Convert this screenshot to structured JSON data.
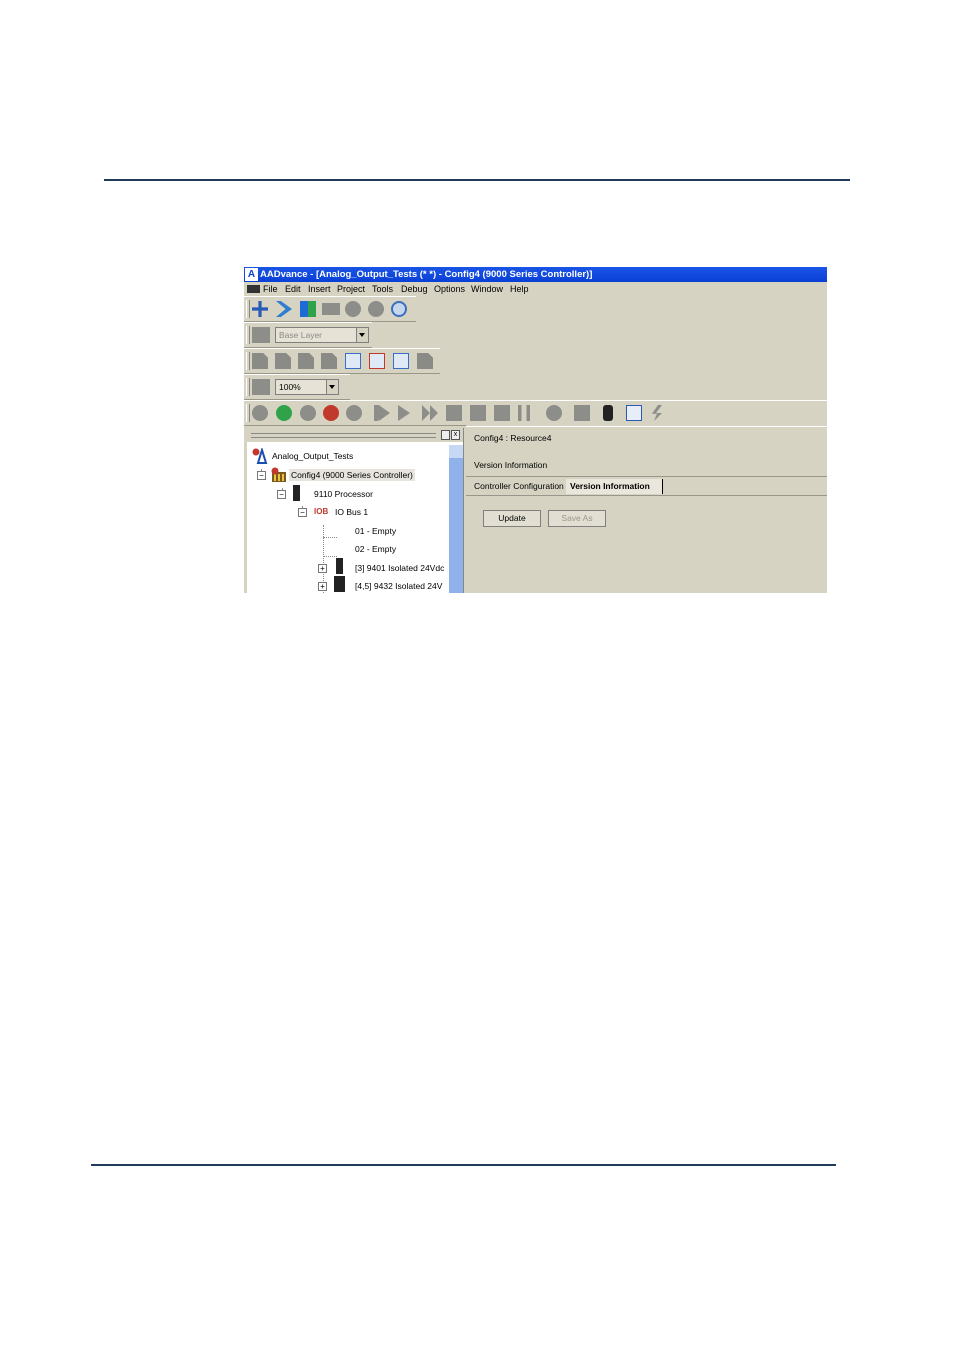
{
  "window": {
    "title": "AADvance - [Analog_Output_Tests (*  *) - Config4 (9000 Series Controller)]",
    "app_icon_letter": "A"
  },
  "menu": {
    "items": [
      "File",
      "Edit",
      "Insert",
      "Project",
      "Tools",
      "Debug",
      "Options",
      "Window",
      "Help"
    ]
  },
  "toolbars": {
    "layer_select_value": "Base Layer",
    "zoom_select_value": "100%"
  },
  "tree": {
    "nodes": [
      {
        "label": "Analog_Output_Tests"
      },
      {
        "label": "Config4 (9000 Series Controller)"
      },
      {
        "label": "9110 Processor"
      },
      {
        "label": "IO Bus 1",
        "prefix": "IOB"
      },
      {
        "label": "01 - Empty"
      },
      {
        "label": "02 - Empty"
      },
      {
        "label": "[3] 9401 Isolated 24Vdc"
      },
      {
        "label": "[4,5] 9432 Isolated 24V"
      }
    ]
  },
  "detail": {
    "breadcrumb": "Config4 : Resource4",
    "section_title": "Version Information",
    "tabs": [
      "Controller Configuration",
      "Version Information"
    ],
    "active_tab": "Version Information",
    "buttons": {
      "update": "Update",
      "save_as": "Save As"
    }
  },
  "colors": {
    "titlebar": "#0a3fd6",
    "window_bg": "#d6d3c3",
    "rule": "#1f3a5a"
  }
}
